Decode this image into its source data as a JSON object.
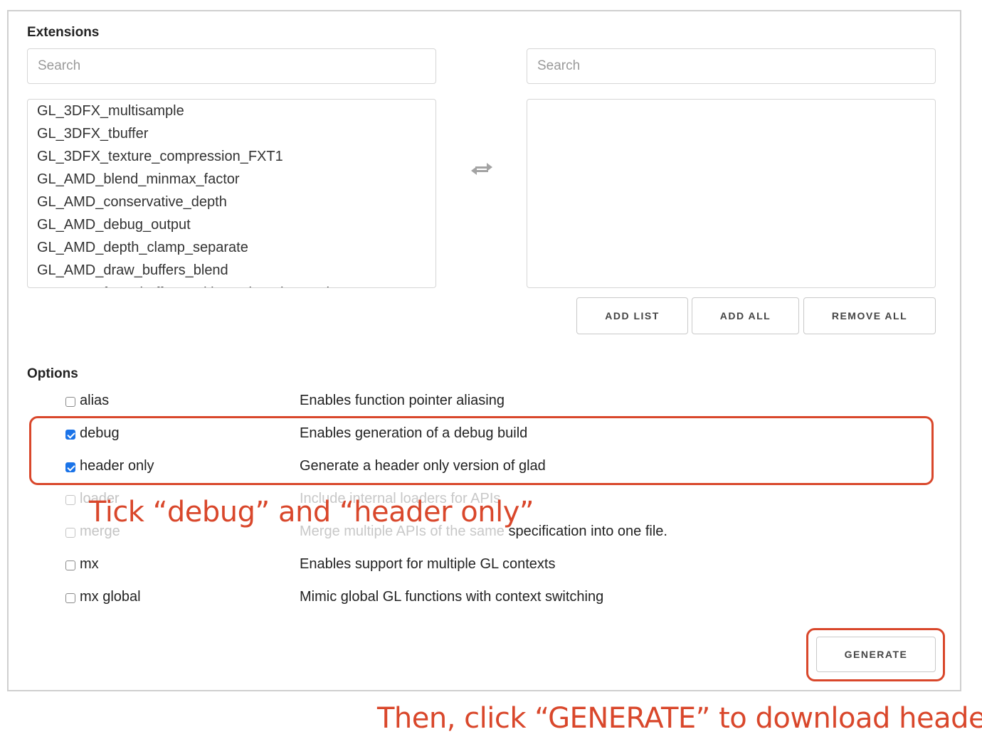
{
  "extensions": {
    "title": "Extensions",
    "left_search_placeholder": "Search",
    "right_search_placeholder": "Search",
    "available": [
      "GL_3DFX_multisample",
      "GL_3DFX_tbuffer",
      "GL_3DFX_texture_compression_FXT1",
      "GL_AMD_blend_minmax_factor",
      "GL_AMD_conservative_depth",
      "GL_AMD_debug_output",
      "GL_AMD_depth_clamp_separate",
      "GL_AMD_draw_buffers_blend",
      "GL_AMD_framebuffer_multisample_advanced"
    ],
    "selected": [],
    "swap_icon": "swap-arrows-icon",
    "buttons": {
      "add_list": "ADD LIST",
      "add_all": "ADD ALL",
      "remove_all": "REMOVE ALL"
    }
  },
  "options": {
    "title": "Options",
    "items": [
      {
        "name": "alias",
        "description": "Enables function pointer aliasing",
        "checked": false
      },
      {
        "name": "debug",
        "description": "Enables generation of a debug build",
        "checked": true
      },
      {
        "name": "header only",
        "description": "Generate a header only version of glad",
        "checked": true
      },
      {
        "name": "loader",
        "description": "Include internal loaders for APIs",
        "checked": false
      },
      {
        "name": "merge",
        "description_faded": "Merge multiple APIs of the same",
        "description": " specification into one file.",
        "checked": false
      },
      {
        "name": "mx",
        "description": "Enables support for multiple GL contexts",
        "checked": false
      },
      {
        "name": "mx global",
        "description": "Mimic global GL functions with context switching",
        "checked": false
      }
    ]
  },
  "generate_label": "GENERATE",
  "annotations": {
    "tick": "Tick “debug” and “header only”",
    "then": "Then, click “GENERATE” to download header."
  },
  "colors": {
    "annotation": "#d9472b",
    "checkbox_checked": "#1a73e8",
    "border": "#cfcfcf"
  }
}
